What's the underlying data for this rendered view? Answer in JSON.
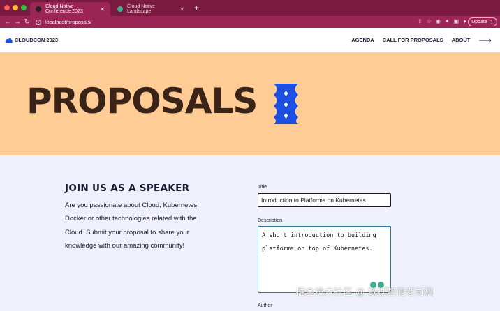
{
  "browser": {
    "tabs": [
      {
        "title": "Cloud-Native Conference 2023",
        "active": true
      },
      {
        "title": "Cloud Native Landscape",
        "active": false
      }
    ],
    "url": "localhost/proposals/",
    "update_label": "Update"
  },
  "site": {
    "logo_text": "CLOUDCON 2023",
    "nav": [
      "AGENDA",
      "CALL FOR PROPOSALS",
      "ABOUT"
    ]
  },
  "hero": {
    "title": "PROPOSALS",
    "background": "#ffcc96",
    "emblem_color": "#1a4fe0"
  },
  "speaker": {
    "heading": "JOIN US AS A SPEAKER",
    "text": "Are you passionate about Cloud, Kubernetes, Docker or other technologies related with the Cloud. Submit your proposal to share your knowledge with our amazing community!"
  },
  "form": {
    "title_label": "Title",
    "title_value": "Introduction to Platforms on Kubernetes",
    "description_label": "Description",
    "description_value": "A short introduction to building platforms on top of Kubernetes.",
    "author_label": "Author"
  },
  "watermark": "掘金技术社区 @ 数据智能老司机"
}
